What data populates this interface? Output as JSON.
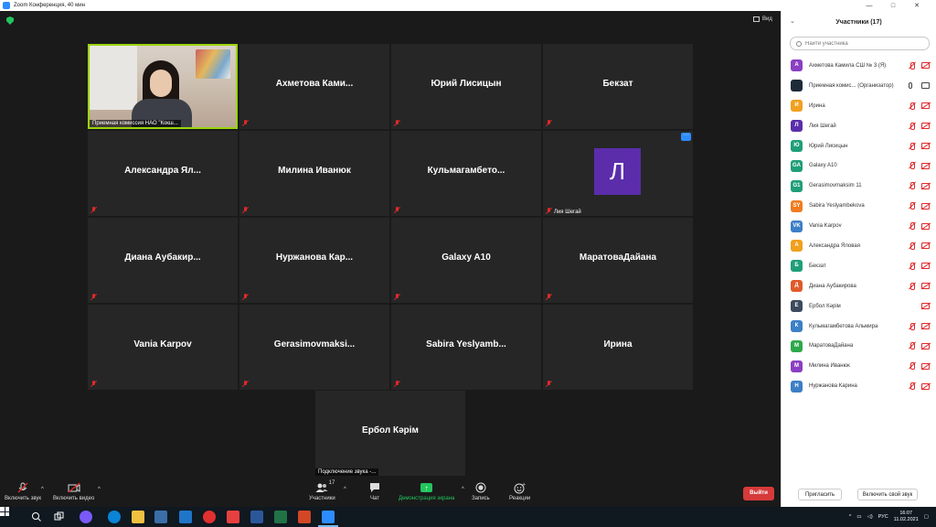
{
  "window": {
    "title": "Zoom Конференция, 40 мин",
    "controls": [
      "—",
      "□",
      "✕"
    ]
  },
  "view_button": "Вид",
  "tiles": {
    "video": {
      "caption": "Приемная комиссия НАО \"Кокш..."
    },
    "r1": [
      "Ахметова  Ками...",
      "Юрий Лисицын",
      "Бекзат"
    ],
    "r2": [
      "Александра  Ял...",
      "Милина Иванюк",
      "Кульмагамбето..."
    ],
    "liya": {
      "initial": "Л",
      "caption": "Лия Шегай",
      "more": "···"
    },
    "r3": [
      "Диана  Аубакир...",
      "Нуржанова  Кар...",
      "Galaxy A10",
      "МаратоваДайана"
    ],
    "r4": [
      "Vania Karpov",
      "Gerasimovmaksi...",
      "Sabira  Yeslyamb...",
      "Ирина"
    ],
    "erbol": {
      "name": "Ербол Кәрім",
      "caption": "Подключение звука -..."
    }
  },
  "toolbar": {
    "audio": "Включить звук",
    "video": "Включить видео",
    "participants": "Участники",
    "participants_count": "17",
    "chat": "Чат",
    "share": "Демонстрация экрана",
    "record": "Запись",
    "reactions": "Реакции",
    "exit": "Выйти"
  },
  "panel": {
    "title": "Участники  (17)",
    "search_placeholder": "Найти участника",
    "participants": [
      {
        "initial": "А",
        "name": "Ахметова Камила СШ № 3 (Я)",
        "color": "#8a3fc2",
        "mic": "off",
        "cam": "off"
      },
      {
        "initial": "",
        "name": "Приемная комис...  (Организатор)",
        "color": "#1e2a38",
        "mic": "on",
        "cam": "on"
      },
      {
        "initial": "И",
        "name": "Ирина",
        "color": "#f0a020",
        "mic": "off",
        "cam": "off"
      },
      {
        "initial": "Л",
        "name": "Лия Шегай",
        "color": "#5b2dab",
        "mic": "off",
        "cam": "off"
      },
      {
        "initial": "Ю",
        "name": "Юрий Лисицын",
        "color": "#1f9e78",
        "mic": "off",
        "cam": "off"
      },
      {
        "initial": "GA",
        "name": "Galaxy A10",
        "color": "#1f9e78",
        "mic": "off",
        "cam": "off"
      },
      {
        "initial": "G1",
        "name": "Gerasimovmaksim 11",
        "color": "#1f9e78",
        "mic": "off",
        "cam": "off"
      },
      {
        "initial": "SY",
        "name": "Sabira Yeslyambekova",
        "color": "#f07b20",
        "mic": "off",
        "cam": "off"
      },
      {
        "initial": "VK",
        "name": "Vania Karpov",
        "color": "#3c7fc6",
        "mic": "off",
        "cam": "off"
      },
      {
        "initial": "А",
        "name": "Александра Яловая",
        "color": "#f0a020",
        "mic": "off",
        "cam": "off"
      },
      {
        "initial": "Б",
        "name": "Бекзат",
        "color": "#1f9e78",
        "mic": "off",
        "cam": "off"
      },
      {
        "initial": "Д",
        "name": "Диана Аубакирова",
        "color": "#e05a2a",
        "mic": "off",
        "cam": "off"
      },
      {
        "initial": "Е",
        "name": "Ербол Кәрім",
        "color": "#3b4a5e",
        "mic": "none",
        "cam": "off"
      },
      {
        "initial": "К",
        "name": "Кульмагамбетова Альмира",
        "color": "#3c7fc6",
        "mic": "off",
        "cam": "off"
      },
      {
        "initial": "М",
        "name": "МаратоваДайана",
        "color": "#2ea84a",
        "mic": "off",
        "cam": "off"
      },
      {
        "initial": "М",
        "name": "Милина Иванюк",
        "color": "#8a3fc2",
        "mic": "off",
        "cam": "off"
      },
      {
        "initial": "Н",
        "name": "Нуржанова Карина",
        "color": "#3c7fc6",
        "mic": "off",
        "cam": "off"
      }
    ],
    "invite": "Пригласить",
    "unmute_self": "Включить свой звук"
  },
  "taskbar": {
    "language": "РУС",
    "time": "16:07",
    "date": "11.02.2021"
  }
}
